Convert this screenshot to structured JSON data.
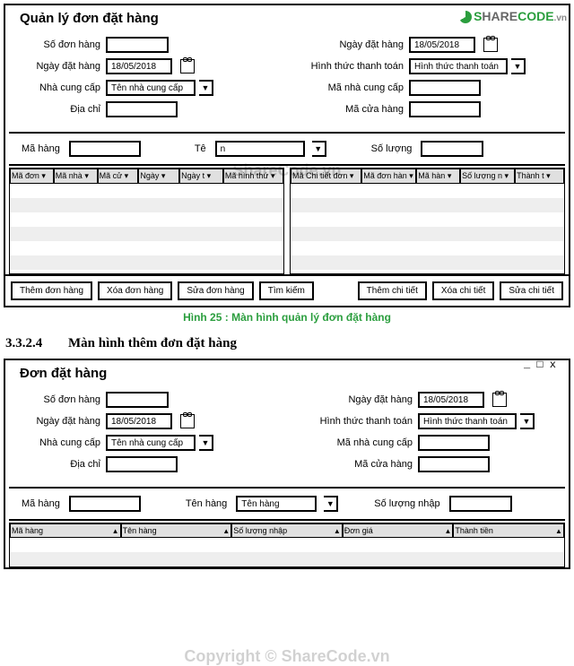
{
  "watermarks": {
    "w1": "ShareCode.vn",
    "w2": "Copyright © ShareCode.vn"
  },
  "logo": {
    "s": "S",
    "hare": "HARE",
    "code": "CODE",
    "vn": ".vn"
  },
  "win1": {
    "title": "Quản lý đơn đặt hàng",
    "left": {
      "sodon": "Số đơn hàng",
      "ngaydat": "Ngày đặt hàng",
      "ngaydat_val": "18/05/2018",
      "nhacc": "Nhà cung cấp",
      "nhacc_val": "Tên nhà cung cấp",
      "diachi": "Địa chỉ"
    },
    "right": {
      "ngaydat": "Ngày đặt hàng",
      "ngaydat_val": "18/05/2018",
      "hinhthuc": "Hình thức thanh toán",
      "hinhthuc_val": "Hình thức thanh toán",
      "manhacc": "Mã nhà cung cấp",
      "macua": "Mã cửa hàng"
    },
    "filter": {
      "mahang": "Mã hàng",
      "tenhang_partial": "Tê",
      "tenhang_val": "n",
      "soluong": "Số lượng"
    },
    "t1": [
      "Mã đơn ▾",
      "Mã nhà ▾",
      "Mã cử ▾",
      "Ngày ▾",
      "Ngày t ▾",
      "Mã hình thứ ▾"
    ],
    "t2": [
      "Mã Chi tiết đơn ▾",
      "Mã đơn hàn ▾",
      "Mã hàn ▾",
      "Số lượng n ▾",
      "Thành t ▾"
    ],
    "buttons": {
      "themdon": "Thêm đơn hàng",
      "xoadon": "Xóa đơn hàng",
      "suadon": "Sửa đơn hàng",
      "timkiem": "Tìm kiếm",
      "themct": "Thêm chi tiết",
      "xoact": "Xóa chi tiết",
      "suact": "Sửa chi tiết"
    }
  },
  "caption": "Hình 25 : Màn hình quản lý đơn đặt hàng",
  "section": {
    "num": "3.3.2.4",
    "title": "Màn hình thêm đơn đặt hàng"
  },
  "win2": {
    "title": "Đơn đặt hàng",
    "winctl": "_ □ x",
    "left": {
      "sodon": "Số đơn hàng",
      "ngaydat": "Ngày đặt hàng",
      "ngaydat_val": "18/05/2018",
      "nhacc": "Nhà cung cấp",
      "nhacc_val": "Tên nhà cung cấp",
      "diachi": "Địa chỉ"
    },
    "right": {
      "ngaydat": "Ngày đặt hàng",
      "ngaydat_val": "18/05/2018",
      "hinhthuc": "Hình thức thanh toán",
      "hinhthuc_val": "Hình thức thanh toán",
      "manhacc": "Mã nhà cung cấp",
      "macua": "Mã cửa hàng"
    },
    "filter": {
      "mahang": "Mã hàng",
      "tenhang": "Tên hàng",
      "tenhang_val": "Tên hàng",
      "soluong": "Số lượng nhập"
    },
    "t": [
      "Mã hàng",
      "Tên hàng",
      "Số lượng nhập",
      "Đơn giá",
      "Thành tiền"
    ]
  }
}
